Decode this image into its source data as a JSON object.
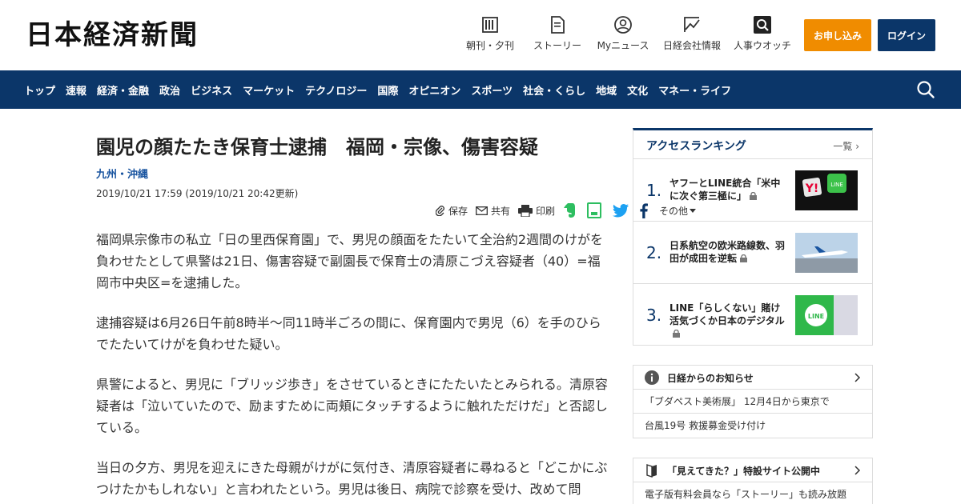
{
  "header": {
    "logo": "日本経済新聞",
    "nav": [
      {
        "label": "朝刊・夕刊",
        "icon": "newspaper-icon"
      },
      {
        "label": "ストーリー",
        "icon": "document-icon"
      },
      {
        "label": "Myニュース",
        "icon": "user-icon"
      },
      {
        "label": "日経会社情報",
        "icon": "chart-icon"
      },
      {
        "label": "人事ウオッチ",
        "icon": "search-person-icon"
      }
    ],
    "apply_label": "お申し込み",
    "login_label": "ログイン",
    "colors": {
      "brand": "#0b3669",
      "apply": "#f08c00"
    }
  },
  "navbar": {
    "items": [
      "トップ",
      "速報",
      "経済・金融",
      "政治",
      "ビジネス",
      "マーケット",
      "テクノロジー",
      "国際",
      "オピニオン",
      "スポーツ",
      "社会・くらし",
      "地域",
      "文化",
      "マネー・ライフ"
    ]
  },
  "article": {
    "title": "園児の顔たたき保育士逮捕　福岡・宗像、傷害容疑",
    "region": "九州・沖縄",
    "date": "2019/10/21 17:59 (2019/10/21 20:42更新)",
    "tools": {
      "save": "保存",
      "share": "共有",
      "print": "印刷",
      "other": "その他"
    },
    "paragraphs": [
      "福岡県宗像市の私立「日の里西保育園」で、男児の顔面をたたいて全治約2週間のけがを負わせたとして県警は21日、傷害容疑で副園長で保育士の清原こづえ容疑者（40）=福岡市中央区=を逮捕した。",
      "逮捕容疑は6月26日午前8時半～同11時半ごろの間に、保育園内で男児（6）を手のひらでたたいてけがを負わせた疑い。",
      "県警によると、男児に「ブリッジ歩き」をさせているときにたたいたとみられる。清原容疑者は「泣いていたので、励ますために両頬にタッチするように触れただけだ」と否認している。",
      "当日の夕方、男児を迎えにきた母親がけがに気付き、清原容疑者に尋ねると「どこかにぶつけたかもしれない」と言われたという。男児は後日、病院で診察を受け、改めて問"
    ]
  },
  "ranking": {
    "title": "アクセスランキング",
    "more": "一覧",
    "items": [
      {
        "rank": "1.",
        "text": "ヤフーとLINE統合「米中に次ぐ第三極に」"
      },
      {
        "rank": "2.",
        "text": "日系航空の欧米路線数、羽田が成田を逆転"
      },
      {
        "rank": "3.",
        "text": "LINE「らしくない」賭け 活気づくか日本のデジタル"
      }
    ]
  },
  "notice": {
    "title": "日経からのお知らせ",
    "items": [
      "「ブダペスト美術展」 12月4日から東京で",
      "台風19号 救援募金受け付け"
    ]
  },
  "special": {
    "title": "「見えてきた？」特設サイト公開中",
    "items": [
      "電子版有料会員なら「ストーリー」も読み放題"
    ]
  }
}
